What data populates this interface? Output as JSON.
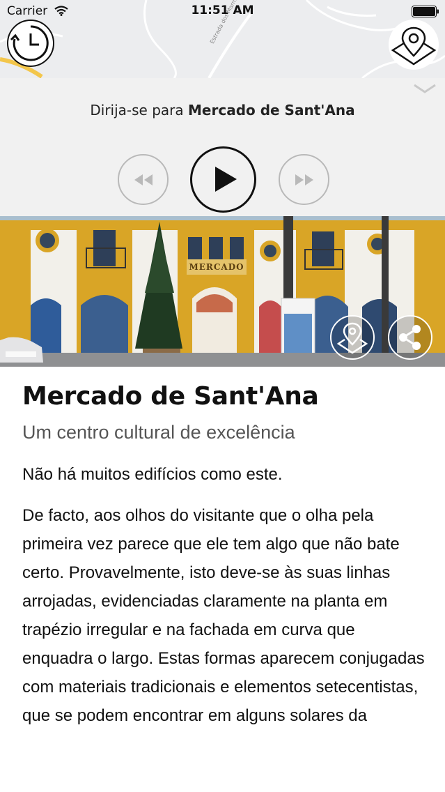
{
  "status_bar": {
    "carrier": "Carrier",
    "time": "11:51 AM"
  },
  "map": {
    "road_label": "Estrada dos Marmeleiros"
  },
  "player": {
    "direction_prefix": "Dirija-se para ",
    "destination": "Mercado de Sant'Ana"
  },
  "photo": {
    "sign_text": "MERCADO"
  },
  "article": {
    "title": "Mercado de Sant'Ana",
    "subtitle": "Um centro cultural de excelência",
    "paragraphs": [
      "Não há muitos edifícios como este.",
      "De facto, aos olhos do visitante que o olha pela primeira vez parece que ele tem algo que não bate certo. Provavelmente, isto deve-se às suas linhas arrojadas, evidenciadas claramente na planta em trapézio irregular e na fachada em curva que enquadra o largo. Estas formas aparecem conjugadas com materiais tradicionais e elementos setecentistas, que se podem encontrar em alguns solares da"
    ]
  },
  "colors": {
    "map_bg": "#ecedef",
    "panel_bg": "#f1f1f1",
    "facade_yellow": "#d9a526"
  }
}
